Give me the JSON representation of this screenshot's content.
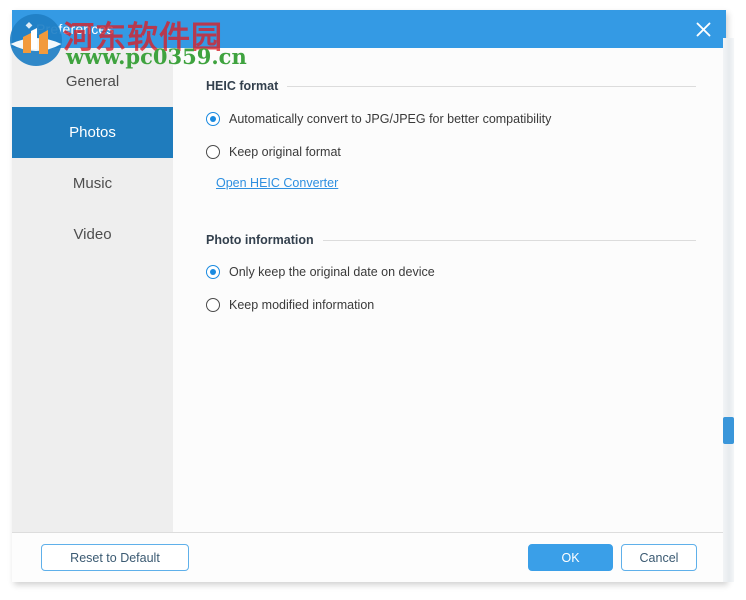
{
  "window": {
    "title": "Preferences",
    "close_icon": "close-icon"
  },
  "sidebar": {
    "items": [
      {
        "label": "General",
        "selected": false
      },
      {
        "label": "Photos",
        "selected": true
      },
      {
        "label": "Music",
        "selected": false
      },
      {
        "label": "Video",
        "selected": false
      }
    ]
  },
  "content": {
    "sections": [
      {
        "title": "HEIC format",
        "options": [
          {
            "label": "Automatically convert to JPG/JPEG for better compatibility",
            "selected": true
          },
          {
            "label": "Keep original format",
            "selected": false
          }
        ],
        "link": "Open HEIC Converter"
      },
      {
        "title": "Photo information",
        "options": [
          {
            "label": "Only keep the original date on device",
            "selected": true
          },
          {
            "label": "Keep modified information",
            "selected": false
          }
        ]
      }
    ]
  },
  "footer": {
    "reset_label": "Reset to Default",
    "ok_label": "OK",
    "cancel_label": "Cancel"
  },
  "watermark": {
    "site_name": "河东软件园",
    "url": "www.pc0359.cn"
  },
  "colors": {
    "titlebar_blue": "#349ae4",
    "selected_item_blue": "#1f7cbd",
    "accent_blue": "#3a9fe8",
    "link_blue": "#2e8fe0",
    "sidebar_gray": "#eeeeee",
    "watermark_red": "#d8222a",
    "watermark_green": "#3fa33f"
  }
}
